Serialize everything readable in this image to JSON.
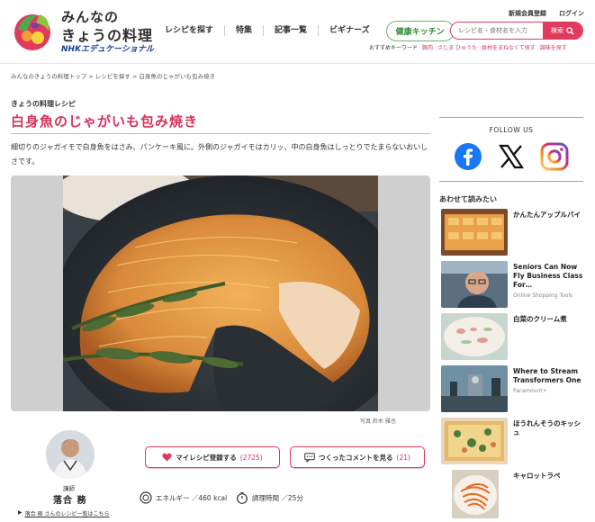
{
  "header": {
    "logo_line1": "みんなの",
    "logo_line2": "きょうの料理",
    "logo_line3": "NHKエデュケーショナル",
    "nav": [
      "レシピを探す",
      "特集",
      "記事一覧",
      "ビギナーズ"
    ],
    "nav_pill": "健康キッチン",
    "register": "新規会員登録",
    "login": "ログイン",
    "search_placeholder": "レシピ名・食材名を入力",
    "search_button": "検索",
    "keyword_label": "おすすめキーワード",
    "keywords": [
      "豚肉",
      "さじま ひゅうた",
      "食材をまねなくて探す",
      "調味を探す"
    ]
  },
  "breadcrumb": [
    "みんなのきょうの料理トップ",
    "レシピを探す",
    "白身魚のじゃがいも包み焼き"
  ],
  "recipe": {
    "section_label": "きょうの料理レシピ",
    "title": "白身魚のじゃがいも包み焼き",
    "description": "細切りのジャガイモで白身魚をはさみ、パンケーキ風に。外側のジャガイモはカリッ、中の白身魚はしっとりでたまらないおいしさです。",
    "photo_credit": "写真 鈴木 雅也",
    "chef_role": "講師",
    "chef_name": "落合 務",
    "chef_link_prefix": "▶",
    "chef_link": "落合 務 さんのレシピ一覧はこちら",
    "myrecipe_label": "マイレシピ登録する",
    "myrecipe_count": "(2725)",
    "comment_label": "つくったコメントを見る",
    "comment_count": "(21)",
    "energy": "エネルギー ／460 kcal",
    "time": "調理時間 ／25分"
  },
  "sidebar": {
    "follow_title": "FOLLOW US",
    "related_title": "あわせて読みたい",
    "related": [
      {
        "title": "かんたんアップルパイ",
        "sub": ""
      },
      {
        "title": "Seniors Can Now Fly Business Class For…",
        "sub": "Online Shopping Tools"
      },
      {
        "title": "白菜のクリーム煮",
        "sub": ""
      },
      {
        "title": "Where to Stream Transformers One",
        "sub": "Paramount+"
      },
      {
        "title": "ほうれんそうのキッシュ",
        "sub": ""
      },
      {
        "title": "キャロットラペ",
        "sub": ""
      }
    ]
  },
  "colors": {
    "accent": "#d6335a",
    "green": "#2e8b3a",
    "nhk_blue": "#1a3f9a"
  }
}
